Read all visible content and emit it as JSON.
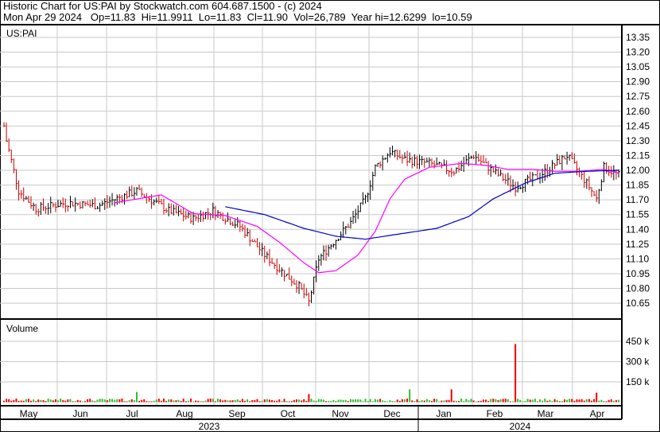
{
  "header": {
    "title": "Historic Chart for US:PAI by Stockwatch.com 604.687.1500 - (c) 2024",
    "quote": "Mon Apr 29 2024   Op=11.83  Hi=11.9911  Lo=11.83  Cl=11.90  Vol=26,789  Year hi=12.6299  lo=10.59"
  },
  "chart_data": {
    "type": "line",
    "symbol": "US:PAI",
    "price_axis": {
      "ylim": [
        10.5,
        13.45
      ],
      "ticks": [
        "13.35",
        "13.20",
        "13.05",
        "12.90",
        "12.75",
        "12.60",
        "12.45",
        "12.30",
        "12.15",
        "12.00",
        "11.85",
        "11.70",
        "11.55",
        "11.40",
        "11.25",
        "11.10",
        "10.95",
        "10.80",
        "10.65"
      ]
    },
    "volume_axis": {
      "label": "Volume",
      "ticks": [
        "450 k",
        "300 k",
        "150 k"
      ],
      "tick_values": [
        450000,
        300000,
        150000
      ]
    },
    "months": [
      "May",
      "Jun",
      "Jul",
      "Aug",
      "Sep",
      "Oct",
      "Nov",
      "Dec",
      "Jan",
      "Feb",
      "Mar",
      "Apr"
    ],
    "years": [
      "2023",
      "2024"
    ],
    "total_days": 251,
    "close_keypoints": [
      [
        0,
        12.45
      ],
      [
        1,
        12.3
      ],
      [
        6,
        11.79
      ],
      [
        13,
        11.61
      ],
      [
        26,
        11.67
      ],
      [
        38,
        11.64
      ],
      [
        54,
        11.79
      ],
      [
        67,
        11.59
      ],
      [
        77,
        11.51
      ],
      [
        85,
        11.59
      ],
      [
        96,
        11.43
      ],
      [
        106,
        11.14
      ],
      [
        111,
        11.02
      ],
      [
        120,
        10.82
      ],
      [
        124,
        10.66
      ],
      [
        128,
        11.1
      ],
      [
        135,
        11.3
      ],
      [
        141,
        11.47
      ],
      [
        147,
        11.71
      ],
      [
        151,
        12.03
      ],
      [
        157,
        12.19
      ],
      [
        163,
        12.11
      ],
      [
        173,
        12.07
      ],
      [
        183,
        11.99
      ],
      [
        191,
        12.15
      ],
      [
        199,
        11.99
      ],
      [
        208,
        11.83
      ],
      [
        218,
        11.95
      ],
      [
        229,
        12.15
      ],
      [
        237,
        11.87
      ],
      [
        241,
        11.71
      ],
      [
        244,
        12.03
      ],
      [
        250,
        11.95
      ]
    ],
    "ma_short": {
      "color": "#ff00ff",
      "points": [
        [
          45,
          11.67
        ],
        [
          64,
          11.75
        ],
        [
          77,
          11.56
        ],
        [
          90,
          11.54
        ],
        [
          103,
          11.43
        ],
        [
          112,
          11.27
        ],
        [
          122,
          11.06
        ],
        [
          128,
          10.96
        ],
        [
          135,
          10.98
        ],
        [
          144,
          11.14
        ],
        [
          151,
          11.38
        ],
        [
          157,
          11.71
        ],
        [
          163,
          11.91
        ],
        [
          173,
          12.03
        ],
        [
          186,
          12.07
        ],
        [
          196,
          12.05
        ],
        [
          205,
          12.01
        ],
        [
          215,
          12.01
        ],
        [
          224,
          11.99
        ],
        [
          234,
          11.99
        ],
        [
          244,
          12.01
        ],
        [
          250,
          11.97
        ]
      ]
    },
    "ma_long": {
      "color": "#0000cc",
      "points": [
        [
          90,
          11.63
        ],
        [
          106,
          11.55
        ],
        [
          122,
          11.41
        ],
        [
          135,
          11.33
        ],
        [
          147,
          11.3
        ],
        [
          160,
          11.35
        ],
        [
          176,
          11.41
        ],
        [
          189,
          11.53
        ],
        [
          199,
          11.71
        ],
        [
          212,
          11.87
        ],
        [
          224,
          11.97
        ],
        [
          237,
          11.99
        ],
        [
          250,
          12.0
        ]
      ]
    },
    "volume": {
      "base": 18000,
      "spikes": [
        [
          124,
          60000
        ],
        [
          165,
          95000
        ],
        [
          182,
          95000
        ],
        [
          208,
          430000
        ],
        [
          54,
          75000
        ],
        [
          241,
          70000
        ]
      ]
    },
    "up_color": "#33bb33",
    "down_color": "#ee0000"
  }
}
